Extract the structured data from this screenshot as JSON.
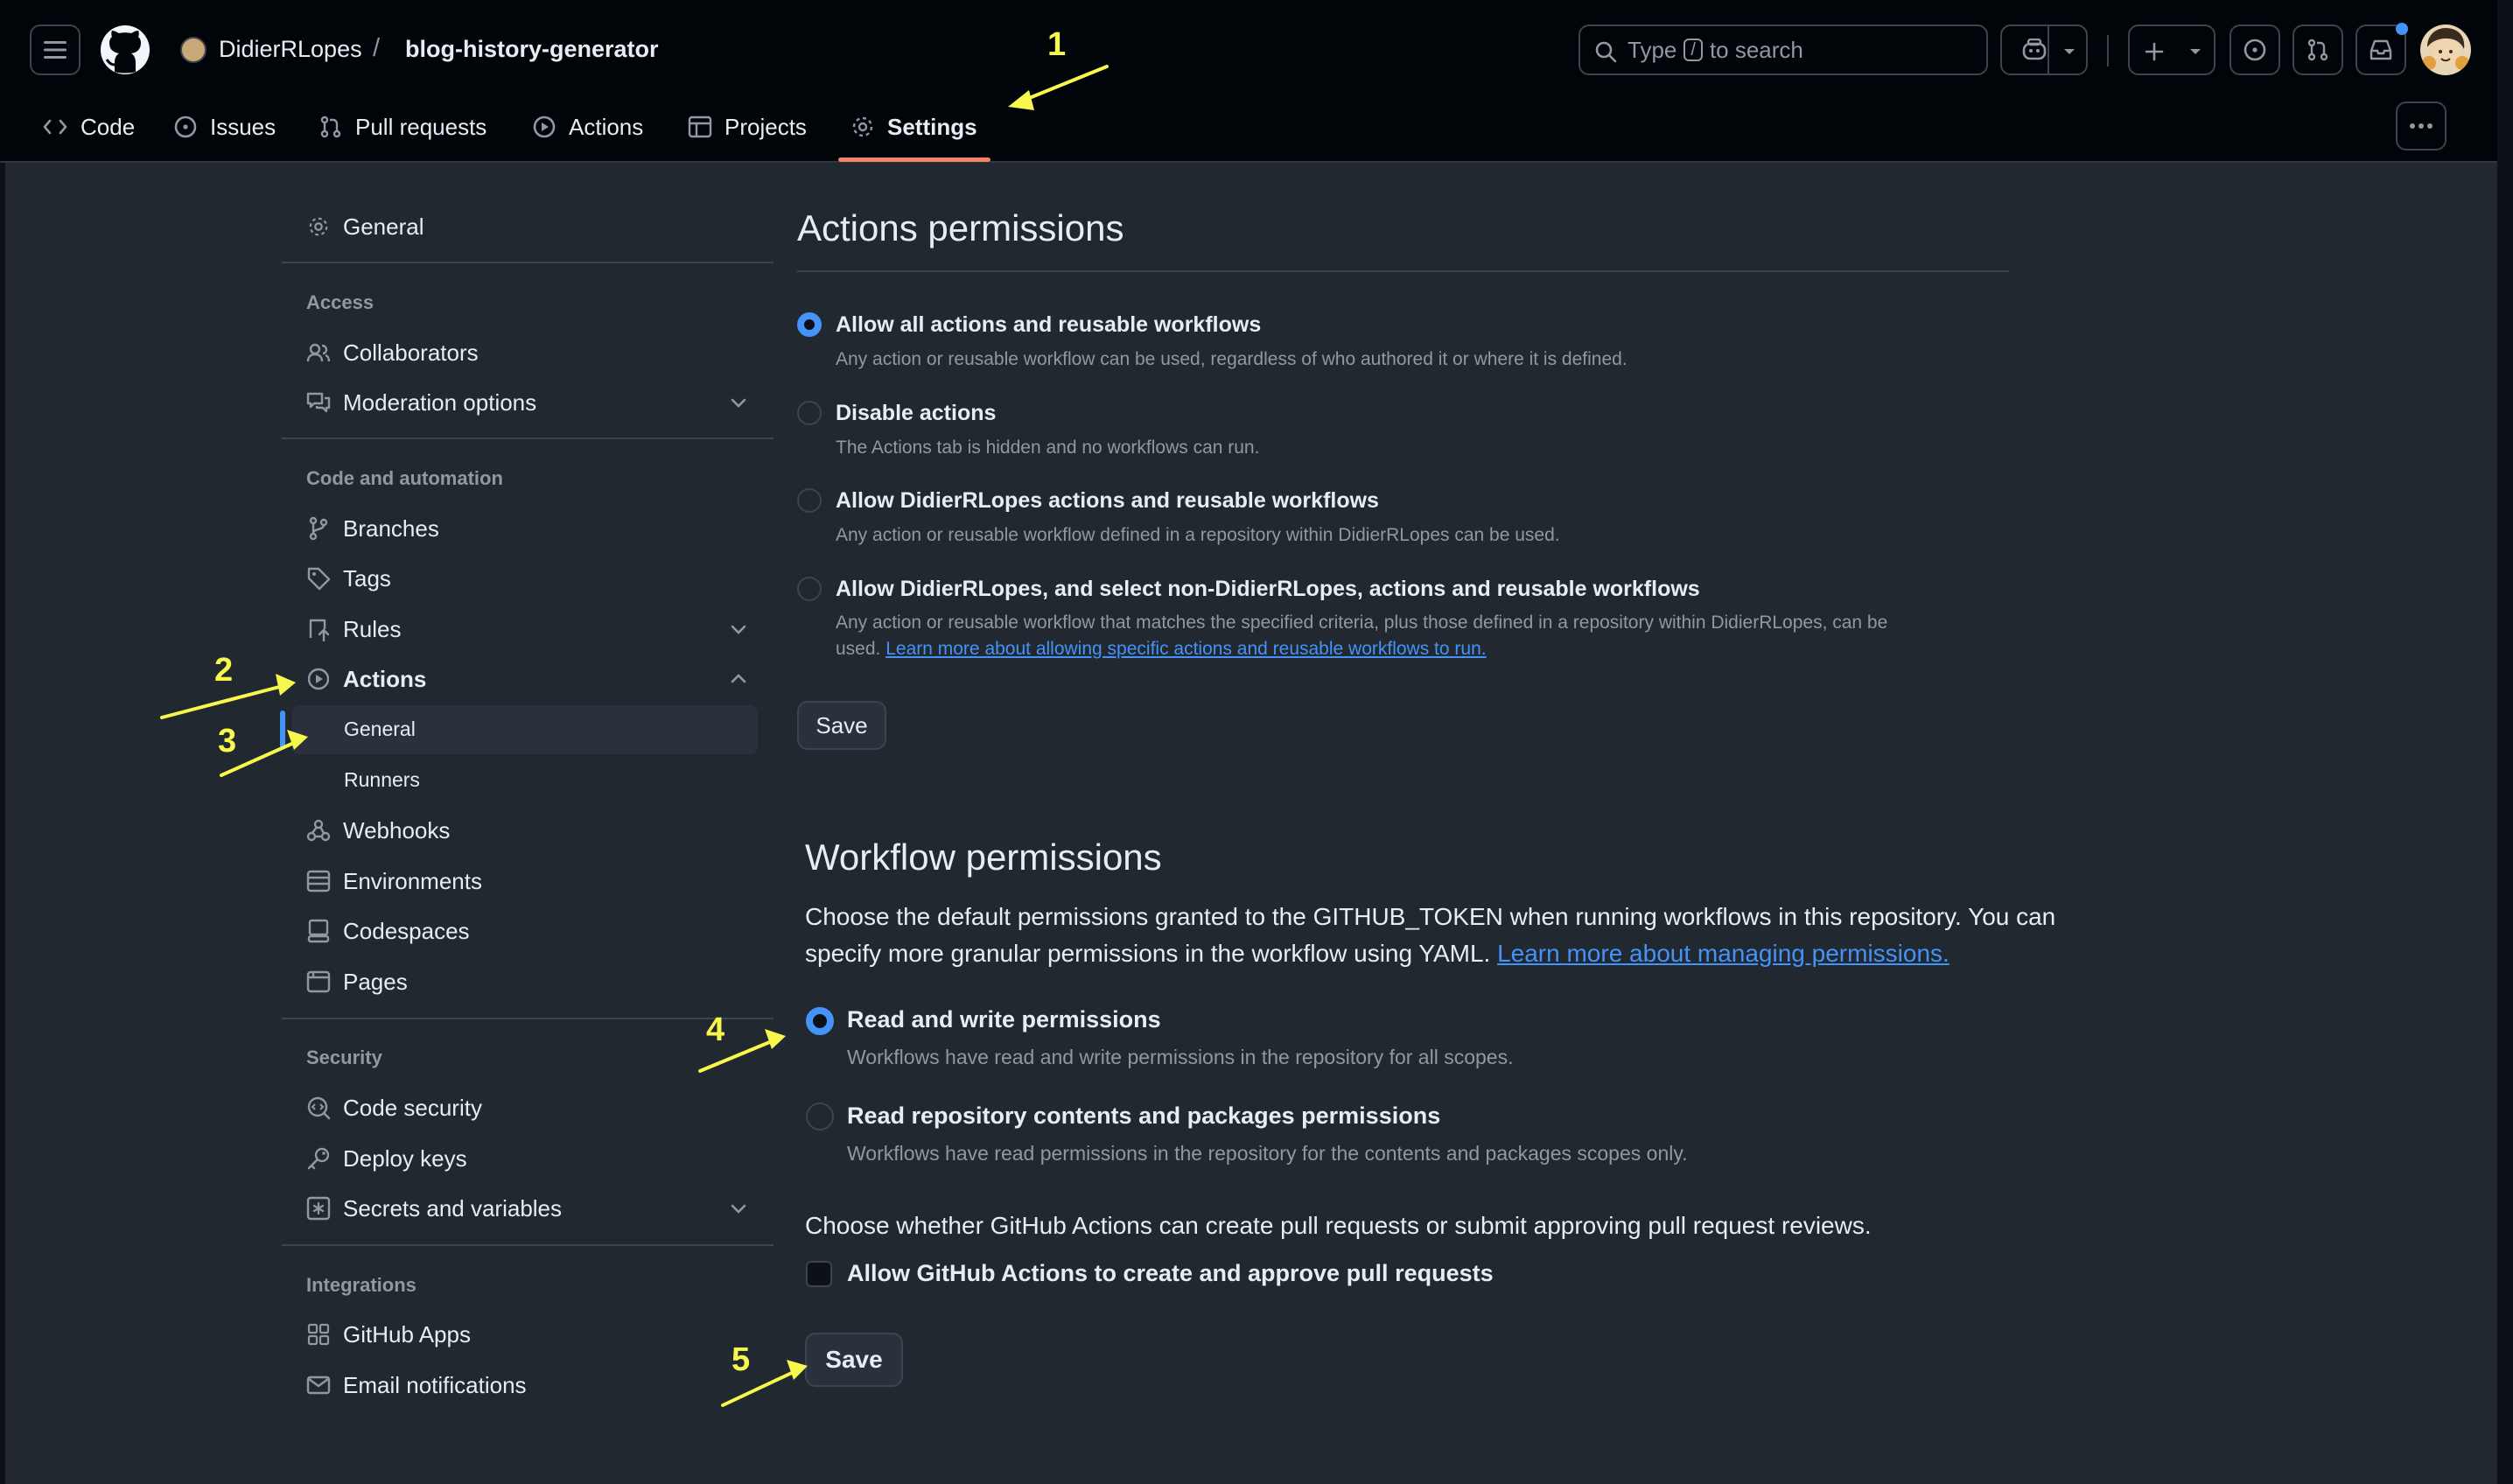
{
  "header": {
    "owner": "DidierRLopes",
    "separator": "/",
    "repo": "blog-history-generator",
    "search": {
      "prefix": "Type",
      "key": "/",
      "suffix": "to search"
    },
    "icons": [
      "menu-icon",
      "github-logo-icon",
      "copilot-icon",
      "plus-icon",
      "issues-icon",
      "pull-requests-icon",
      "inbox-icon",
      "avatar"
    ]
  },
  "tabs": [
    {
      "label": "Code",
      "icon": "code-icon"
    },
    {
      "label": "Issues",
      "icon": "issue-icon"
    },
    {
      "label": "Pull requests",
      "icon": "pull-request-icon"
    },
    {
      "label": "Actions",
      "icon": "play-icon"
    },
    {
      "label": "Projects",
      "icon": "table-icon"
    },
    {
      "label": "Settings",
      "icon": "gear-icon",
      "selected": true
    }
  ],
  "sidebar": {
    "general": "General",
    "access_heading": "Access",
    "collaborators": "Collaborators",
    "moderation": "Moderation options",
    "code_heading": "Code and automation",
    "branches": "Branches",
    "tags": "Tags",
    "rules": "Rules",
    "actions": "Actions",
    "actions_general": "General",
    "actions_runners": "Runners",
    "webhooks": "Webhooks",
    "environments": "Environments",
    "codespaces": "Codespaces",
    "pages": "Pages",
    "security_heading": "Security",
    "code_security": "Code security",
    "deploy_keys": "Deploy keys",
    "secrets": "Secrets and variables",
    "integrations_heading": "Integrations",
    "github_apps": "GitHub Apps",
    "email_notifications": "Email notifications"
  },
  "actions_permissions": {
    "title": "Actions permissions",
    "options": [
      {
        "title": "Allow all actions and reusable workflows",
        "desc": "Any action or reusable workflow can be used, regardless of who authored it or where it is defined.",
        "checked": true
      },
      {
        "title": "Disable actions",
        "desc": "The Actions tab is hidden and no workflows can run.",
        "checked": false
      },
      {
        "title": "Allow DidierRLopes actions and reusable workflows",
        "desc": "Any action or reusable workflow defined in a repository within DidierRLopes can be used.",
        "checked": false
      },
      {
        "title": "Allow DidierRLopes, and select non-DidierRLopes, actions and reusable workflows",
        "desc_line1": "Any action or reusable workflow that matches the specified criteria, plus those defined in a repository within DidierRLopes, can be",
        "desc_line2": "used.",
        "link": "Learn more about allowing specific actions and reusable workflows to run.",
        "checked": false
      }
    ],
    "save": "Save"
  },
  "workflow_permissions": {
    "title": "Workflow permissions",
    "intro_line1": "Choose the default permissions granted to the GITHUB_TOKEN when running workflows in this repository. You can",
    "intro_line2": "specify more granular permissions in the workflow using YAML.",
    "intro_link": "Learn more about managing permissions.",
    "options": [
      {
        "title": "Read and write permissions",
        "desc": "Workflows have read and write permissions in the repository for all scopes.",
        "checked": true
      },
      {
        "title": "Read repository contents and packages permissions",
        "desc": "Workflows have read permissions in the repository for the contents and packages scopes only.",
        "checked": false
      }
    ],
    "pr_question": "Choose whether GitHub Actions can create pull requests or submit approving pull request reviews.",
    "pr_checkbox": "Allow GitHub Actions to create and approve pull requests",
    "pr_checkbox_checked": false,
    "save": "Save"
  },
  "annotations": [
    "1",
    "2",
    "3",
    "4",
    "5"
  ],
  "colors": {
    "accent": "#4493f8",
    "tab_underline": "#f78166",
    "annotation": "#f8f84c"
  }
}
